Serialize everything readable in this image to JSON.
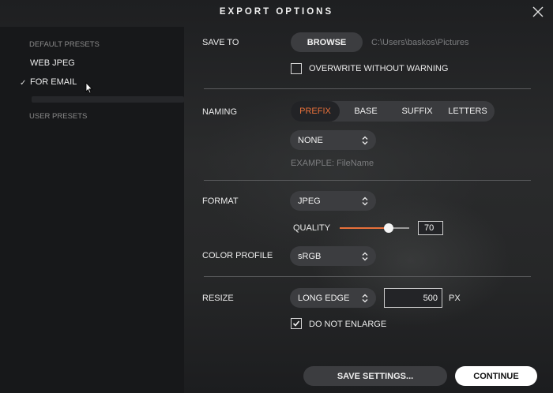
{
  "dialog": {
    "title": "EXPORT OPTIONS"
  },
  "sidebar": {
    "default_heading": "DEFAULT PRESETS",
    "presets": [
      {
        "label": "WEB JPEG",
        "selected": false
      },
      {
        "label": "FOR EMAIL",
        "selected": true
      }
    ],
    "user_heading": "USER PRESETS"
  },
  "save_to": {
    "label": "SAVE TO",
    "browse_label": "BROWSE",
    "path": "C:\\Users\\baskos\\Pictures",
    "overwrite_label": "OVERWRITE WITHOUT WARNING",
    "overwrite_checked": false
  },
  "naming": {
    "label": "NAMING",
    "tabs": [
      "PREFIX",
      "BASE",
      "SUFFIX",
      "LETTERS"
    ],
    "active_tab": "PREFIX",
    "value": "NONE",
    "example": "EXAMPLE: FileName"
  },
  "format": {
    "label": "FORMAT",
    "value": "JPEG",
    "quality_label": "QUALITY",
    "quality_value": "70",
    "quality_fraction": 0.7
  },
  "color_profile": {
    "label": "COLOR PROFILE",
    "value": "sRGB"
  },
  "resize": {
    "label": "RESIZE",
    "mode": "LONG EDGE",
    "value": "500",
    "unit": "PX",
    "no_enlarge_label": "DO NOT ENLARGE",
    "no_enlarge_checked": true
  },
  "footer": {
    "save_settings_label": "SAVE SETTINGS...",
    "continue_label": "CONTINUE"
  },
  "colors": {
    "accent": "#e8703a",
    "sidebar_bg": "#17181a",
    "control_bg": "#3c3d40"
  }
}
